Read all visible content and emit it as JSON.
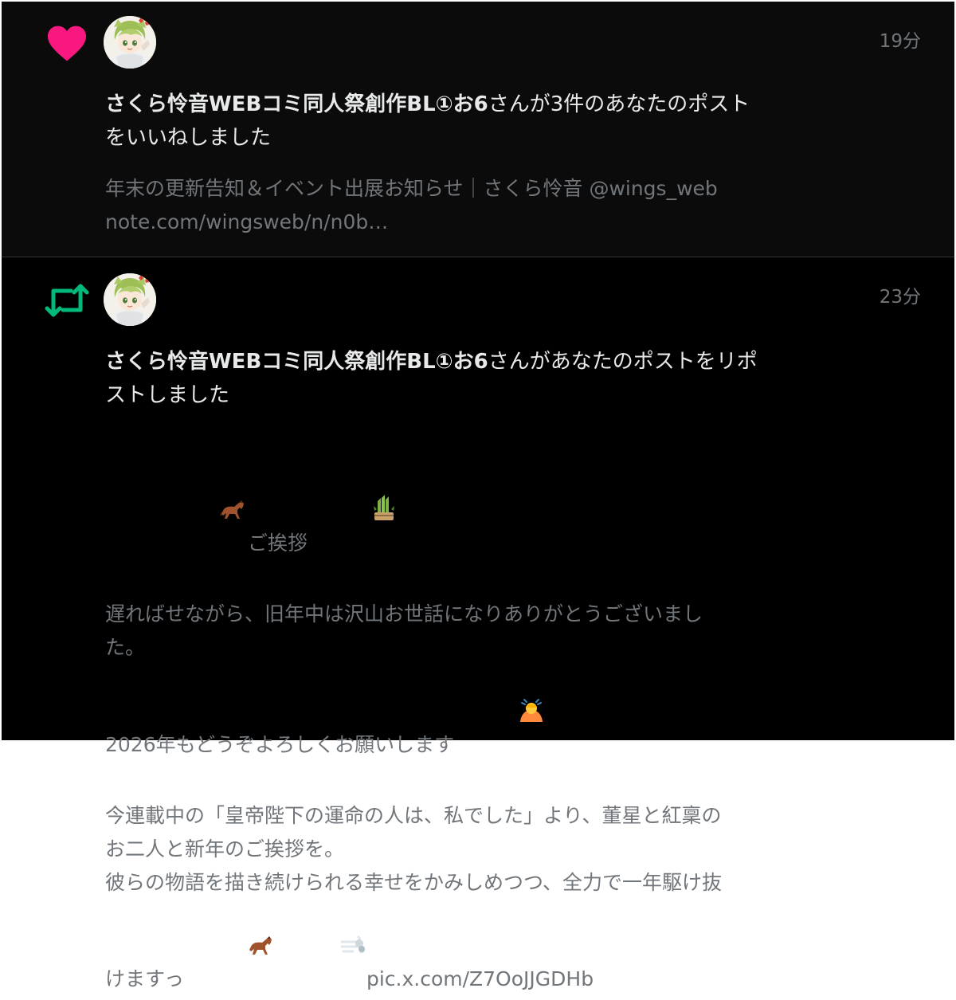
{
  "notifications": [
    {
      "type": "like",
      "icon": "heart-icon",
      "icon_color": "#f91880",
      "time": "19分",
      "user": "さくら怜音WEBコミ同人祭創作BL①お6",
      "action_line1": "さんが3件のあなたのポスト",
      "action_line2": "をいいねしました",
      "quote_line1": "年末の更新告知＆イベント出展お知らせ｜さくら怜音 @wings_web",
      "quote_line2": "note.com/wingsweb/n/n0b…"
    },
    {
      "type": "repost",
      "icon": "repost-icon",
      "icon_color": "#00ba7c",
      "time": "23分",
      "user": "さくら怜音WEBコミ同人祭創作BL①お6",
      "action_line1": "さんがあなたのポストをリポ",
      "action_line2": "ストしました",
      "post": {
        "line1": "ご挨拶",
        "line2": "遅ればせながら、旧年中は沢山お世話になりありがとうございまし",
        "line3": "た。",
        "line4": "2026年もどうぞよろしくお願いします",
        "line5": "今連載中の「皇帝陛下の運命の人は、私でした」より、董星と紅稟の",
        "line6": "お二人と新年のご挨拶を。",
        "line7": "彼らの物語を描き続けられる幸せをかみしめつつ、全力で一年駆け抜",
        "line8": "けますっ",
        "link": "pic.x.com/Z7OoJJGDHb"
      },
      "emoji_names": [
        "horse-emoji",
        "kadomatsu-emoji",
        "bowing-person-emoji",
        "dash-emoji"
      ]
    }
  ],
  "colors": {
    "background": "#000000",
    "text_primary": "#e7e9ea",
    "text_secondary": "#71767b",
    "divider": "#2f3336"
  }
}
